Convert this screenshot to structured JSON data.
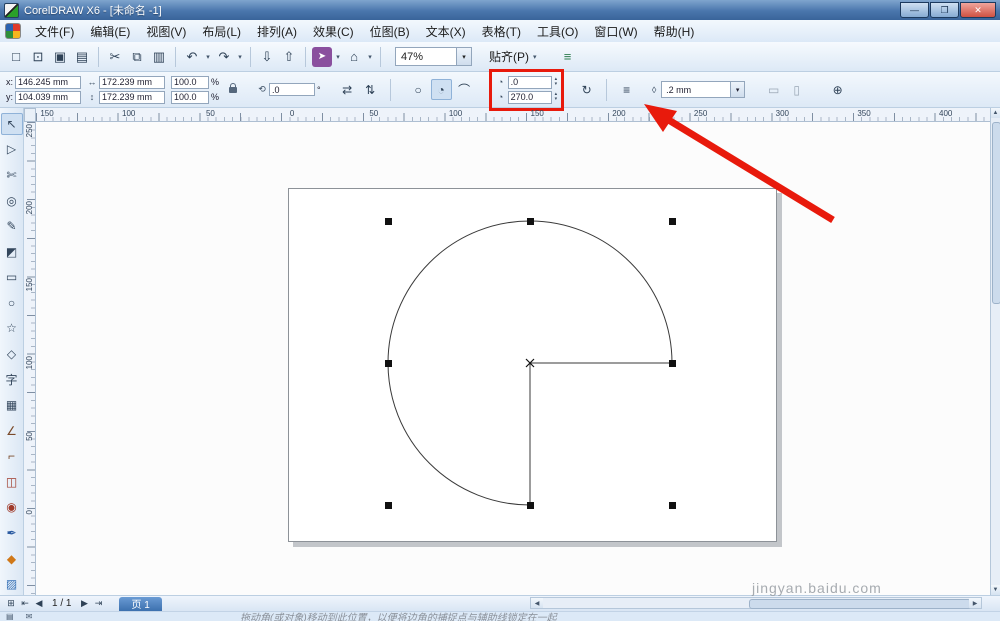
{
  "window": {
    "title": "CorelDRAW X6 - [未命名 -1]",
    "buttons": {
      "minimize": "—",
      "maximize": "❐",
      "close": "✕"
    }
  },
  "menu": {
    "items": [
      "文件(F)",
      "编辑(E)",
      "视图(V)",
      "布局(L)",
      "排列(A)",
      "效果(C)",
      "位图(B)",
      "文本(X)",
      "表格(T)",
      "工具(O)",
      "窗口(W)",
      "帮助(H)"
    ]
  },
  "toolbar": {
    "items": [
      {
        "name": "new-document-icon",
        "glyph": "□"
      },
      {
        "name": "open-icon",
        "glyph": "⊡"
      },
      {
        "name": "save-icon",
        "glyph": "▣"
      },
      {
        "name": "print-icon",
        "glyph": "▤"
      },
      {
        "sep": true
      },
      {
        "name": "cut-icon",
        "glyph": "✂"
      },
      {
        "name": "copy-icon",
        "glyph": "⧉"
      },
      {
        "name": "paste-icon",
        "glyph": "▥"
      },
      {
        "sep": true
      },
      {
        "name": "undo-icon",
        "glyph": "↶",
        "caret": true
      },
      {
        "name": "redo-icon",
        "glyph": "↷",
        "caret": true
      },
      {
        "sep": true
      },
      {
        "name": "import-icon",
        "glyph": "⇩"
      },
      {
        "name": "export-icon",
        "glyph": "⇧"
      },
      {
        "sep": true
      },
      {
        "name": "application-launcher-icon",
        "glyph": "➤",
        "bg": "#8a4f9e",
        "fg": "#ffffff",
        "caret": true
      },
      {
        "name": "welcome-screen-icon",
        "glyph": "⌂",
        "caret": true
      },
      {
        "sep": true
      }
    ],
    "zoom_value": "47%",
    "snap_label": "贴齐(P)",
    "options_glyph": "≡"
  },
  "property_bar": {
    "x_label": "x:",
    "x_value": "146.245 mm",
    "y_label": "y:",
    "y_value": "104.039 mm",
    "width_value": "172.239 mm",
    "height_value": "172.239 mm",
    "scale_x_value": "100.0",
    "scale_y_value": "100.0",
    "percent": "%",
    "rotation_value": ".0",
    "degree": "°",
    "pie_start_value": ".0",
    "pie_end_value": "270.0",
    "outline_width_value": ".2 mm",
    "icons": {
      "width_arrow": "↔",
      "height_arrow": "↕",
      "rotation": "⟲",
      "mirror_horizontal": "⇄",
      "mirror_vertical": "⇅",
      "ellipse": "○",
      "pie": "◔",
      "arc": "⌒",
      "pie_angle": "◔",
      "direction": "↻",
      "wrap": "≡",
      "outline_pen": "◊",
      "to_front": "▭",
      "to_back": "▯",
      "quick_customize": "⊕",
      "spin_up": "▴",
      "spin_down": "▾",
      "caret": "▾"
    }
  },
  "rulers": {
    "horizontal_labels": [
      "150",
      "100",
      "50",
      "0",
      "50",
      "100",
      "150",
      "200",
      "250",
      "300",
      "350",
      "400"
    ],
    "vertical_labels": [
      "250",
      "200",
      "150",
      "100",
      "50",
      "0"
    ]
  },
  "toolbox": {
    "tools": [
      {
        "name": "pick-tool",
        "glyph": "↖",
        "active": true
      },
      {
        "name": "shape-tool",
        "glyph": "▷"
      },
      {
        "name": "crop-tool",
        "glyph": "✄"
      },
      {
        "name": "zoom-tool",
        "glyph": "◎"
      },
      {
        "name": "freehand-tool",
        "glyph": "✎"
      },
      {
        "name": "smart-fill-tool",
        "glyph": "◩"
      },
      {
        "name": "rectangle-tool",
        "glyph": "▭"
      },
      {
        "name": "ellipse-tool",
        "glyph": "○"
      },
      {
        "name": "polygon-tool",
        "glyph": "☆"
      },
      {
        "name": "basic-shapes-tool",
        "glyph": "◇"
      },
      {
        "name": "text-tool",
        "glyph": "字"
      },
      {
        "name": "table-tool",
        "glyph": "▦"
      },
      {
        "name": "parallel-dimension-tool",
        "glyph": "∠",
        "color": "#7a4a2a"
      },
      {
        "name": "connector-tool",
        "glyph": "⌐",
        "color": "#7a4a2a"
      },
      {
        "name": "blend-tool",
        "glyph": "◫",
        "color": "#a03a2a"
      },
      {
        "name": "contour-tool",
        "glyph": "◉",
        "color": "#a03a2a"
      },
      {
        "name": "color-eyedropper-tool",
        "glyph": "✒",
        "color": "#2a5aa0"
      },
      {
        "name": "fill-tool",
        "glyph": "◆",
        "color": "#d07818"
      },
      {
        "name": "interactive-fill-tool",
        "glyph": "▨",
        "color": "#3a74b8"
      }
    ]
  },
  "canvas": {
    "selected_object": {
      "type": "pie",
      "start_angle_deg": 0,
      "end_angle_deg": 270,
      "width": "172.239 mm",
      "height": "172.239 mm"
    }
  },
  "page_bar": {
    "page_info": "1 / 1",
    "page_tab": "页 1",
    "icons": {
      "add_page": "⊞",
      "first": "⇤",
      "prev": "◀",
      "next": "▶",
      "last": "⇥"
    }
  },
  "status_bar": {
    "hint": "拖动角(或对象)移动到此位置，以便将边角的捕捉点与辅助线锁定在一起",
    "icons": {
      "doc": "▤",
      "mail": "✉"
    }
  },
  "watermark": {
    "text": "jingyan.baidu.com"
  },
  "colors": {
    "annotation_red": "#e81a0c",
    "titlebar_blue": "#3f6daa",
    "selection_black": "#111111"
  }
}
